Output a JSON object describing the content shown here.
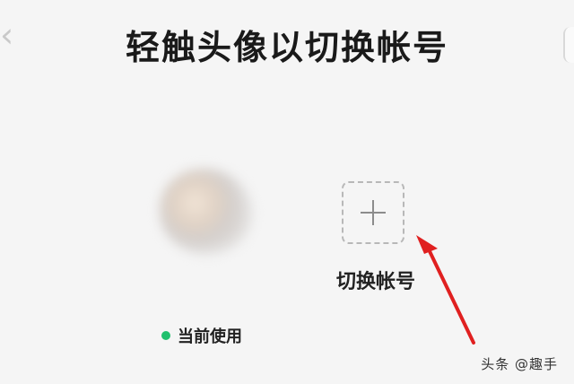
{
  "header": {
    "title": "轻触头像以切换帐号"
  },
  "accounts": {
    "current_status": "当前使用",
    "status_color": "#20c06d",
    "add_icon": "plus-icon",
    "switch_label": "切换帐号"
  },
  "annotation": {
    "arrow_color": "#e02020"
  },
  "watermark": {
    "text": "头条 @趣手"
  }
}
